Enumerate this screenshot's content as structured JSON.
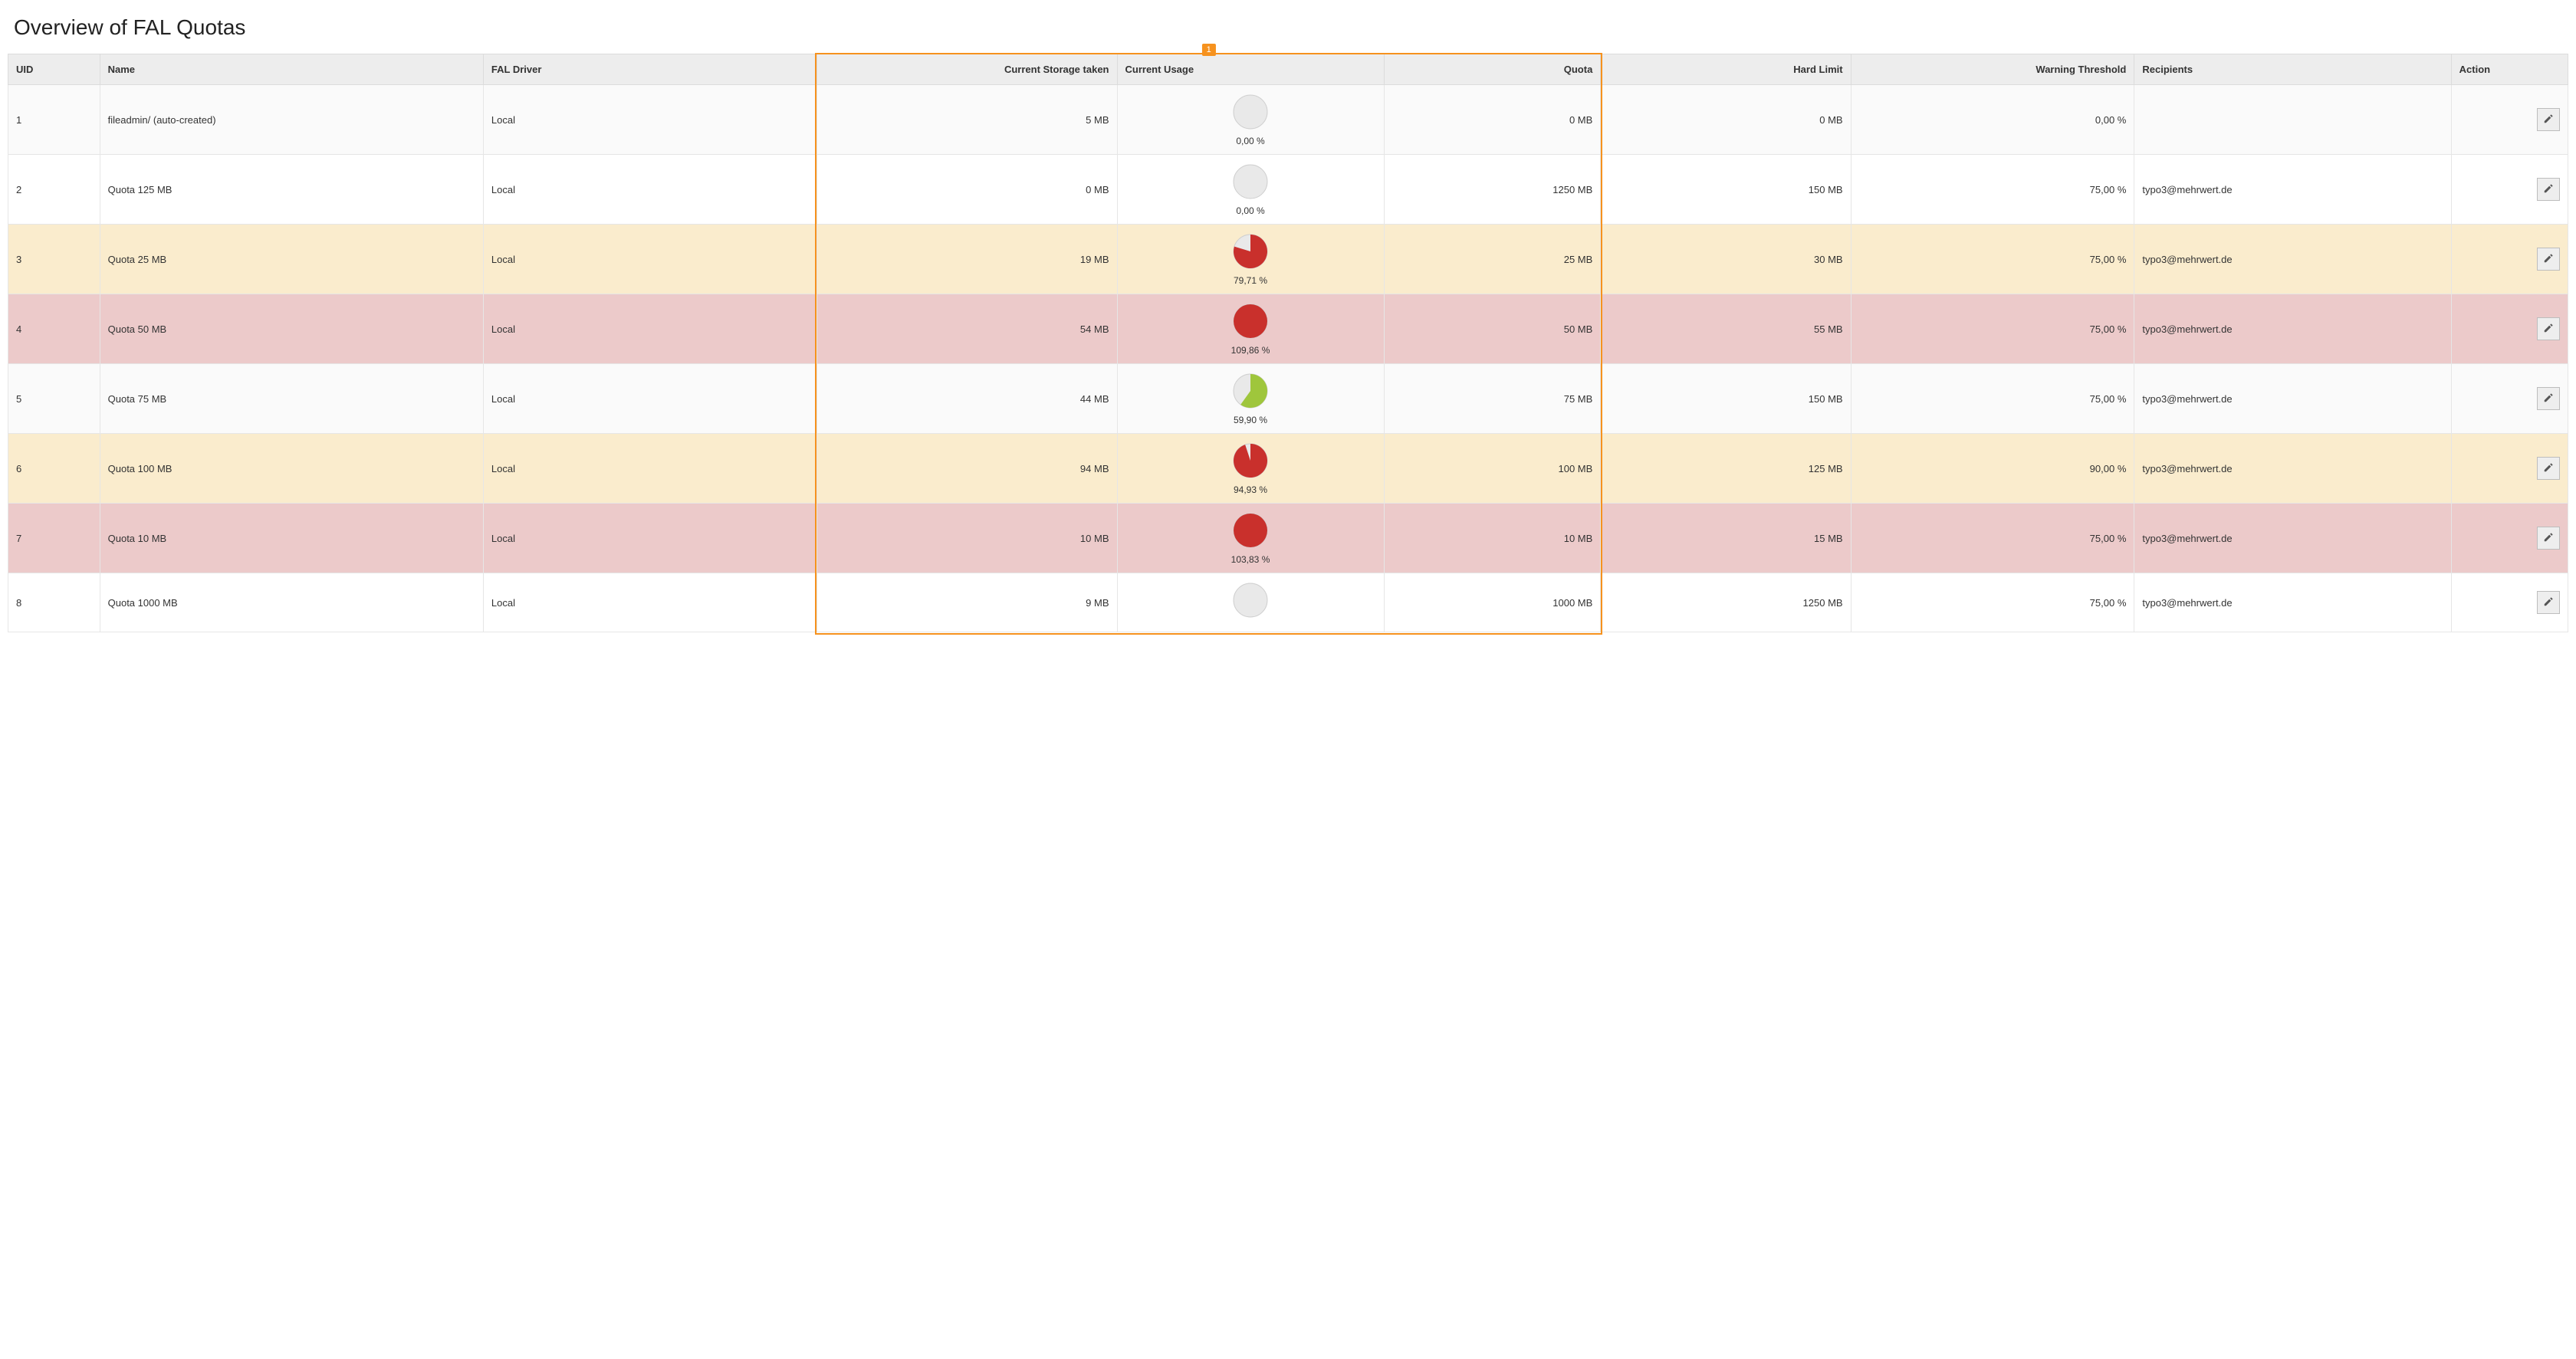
{
  "title": "Overview of FAL Quotas",
  "headers": {
    "uid": "UID",
    "name": "Name",
    "driver": "FAL Driver",
    "storage": "Current Storage taken",
    "usage": "Current Usage",
    "quota": "Quota",
    "hard": "Hard Limit",
    "thresh": "Warning Threshold",
    "recipients": "Recipients",
    "action": "Action"
  },
  "highlight_badge": "1",
  "colors": {
    "pie_bg": "#e9e9e9",
    "pie_stroke": "#cfcfcf",
    "green": "#9fc63c",
    "red": "#c9302c",
    "orange": "#f6921e",
    "row_default": "#fafafa",
    "row_warn": "#faeccd",
    "row_danger": "#eccaca"
  },
  "rows": [
    {
      "uid": "1",
      "name": "fileadmin/ (auto-created)",
      "driver": "Local",
      "storage": "5 MB",
      "usage_percent": 0,
      "usage_label": "0,00 %",
      "usage_color": "none",
      "quota": "0 MB",
      "hard": "0 MB",
      "thresh": "0,00 %",
      "recipients": "",
      "state": "default"
    },
    {
      "uid": "2",
      "name": "Quota 125 MB",
      "driver": "Local",
      "storage": "0 MB",
      "usage_percent": 0,
      "usage_label": "0,00 %",
      "usage_color": "none",
      "quota": "1250 MB",
      "hard": "150 MB",
      "thresh": "75,00 %",
      "recipients": "typo3@mehrwert.de",
      "state": "default"
    },
    {
      "uid": "3",
      "name": "Quota 25 MB",
      "driver": "Local",
      "storage": "19 MB",
      "usage_percent": 79.71,
      "usage_label": "79,71 %",
      "usage_color": "red",
      "quota": "25 MB",
      "hard": "30 MB",
      "thresh": "75,00 %",
      "recipients": "typo3@mehrwert.de",
      "state": "warn"
    },
    {
      "uid": "4",
      "name": "Quota 50 MB",
      "driver": "Local",
      "storage": "54 MB",
      "usage_percent": 109.86,
      "usage_label": "109,86 %",
      "usage_color": "red",
      "quota": "50 MB",
      "hard": "55 MB",
      "thresh": "75,00 %",
      "recipients": "typo3@mehrwert.de",
      "state": "danger"
    },
    {
      "uid": "5",
      "name": "Quota 75 MB",
      "driver": "Local",
      "storage": "44 MB",
      "usage_percent": 59.9,
      "usage_label": "59,90 %",
      "usage_color": "green",
      "quota": "75 MB",
      "hard": "150 MB",
      "thresh": "75,00 %",
      "recipients": "typo3@mehrwert.de",
      "state": "default"
    },
    {
      "uid": "6",
      "name": "Quota 100 MB",
      "driver": "Local",
      "storage": "94 MB",
      "usage_percent": 94.93,
      "usage_label": "94,93 %",
      "usage_color": "red",
      "quota": "100 MB",
      "hard": "125 MB",
      "thresh": "90,00 %",
      "recipients": "typo3@mehrwert.de",
      "state": "warn"
    },
    {
      "uid": "7",
      "name": "Quota 10 MB",
      "driver": "Local",
      "storage": "10 MB",
      "usage_percent": 103.83,
      "usage_label": "103,83 %",
      "usage_color": "red",
      "quota": "10 MB",
      "hard": "15 MB",
      "thresh": "75,00 %",
      "recipients": "typo3@mehrwert.de",
      "state": "danger"
    },
    {
      "uid": "8",
      "name": "Quota 1000 MB",
      "driver": "Local",
      "storage": "9 MB",
      "usage_percent": 0,
      "usage_label": "",
      "usage_color": "none",
      "quota": "1000 MB",
      "hard": "1250 MB",
      "thresh": "75,00 %",
      "recipients": "typo3@mehrwert.de",
      "state": "default"
    }
  ]
}
